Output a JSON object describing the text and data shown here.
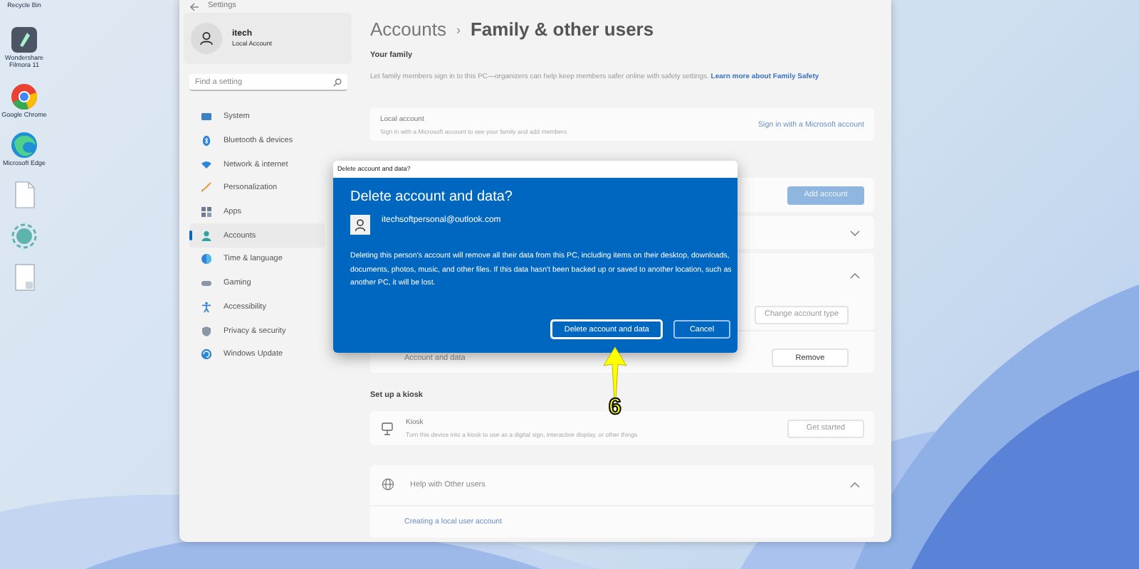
{
  "desktop": {
    "icons": [
      {
        "kind": "label",
        "label": "Recycle Bin"
      },
      {
        "kind": "filmora",
        "label": "Wondershare Filmora 11"
      },
      {
        "kind": "chrome",
        "label": "Google Chrome"
      },
      {
        "kind": "edge",
        "label": "Microsoft Edge"
      },
      {
        "kind": "file"
      },
      {
        "kind": "disc"
      },
      {
        "kind": "doc"
      }
    ]
  },
  "window": {
    "title": "Settings",
    "user": {
      "name": "itech",
      "type": "Local Account"
    },
    "search": {
      "placeholder": "Find a setting"
    },
    "sidebar": {
      "items": [
        {
          "kind": "system",
          "label": "System",
          "selected": false
        },
        {
          "kind": "bluetooth",
          "label": "Bluetooth & devices",
          "selected": false
        },
        {
          "kind": "network",
          "label": "Network & internet",
          "selected": false
        },
        {
          "kind": "personalization",
          "label": "Personalization",
          "selected": false
        },
        {
          "kind": "apps",
          "label": "Apps",
          "selected": false
        },
        {
          "kind": "accounts",
          "label": "Accounts",
          "selected": true
        },
        {
          "kind": "time",
          "label": "Time & language",
          "selected": false
        },
        {
          "kind": "gaming",
          "label": "Gaming",
          "selected": false
        },
        {
          "kind": "accessibility",
          "label": "Accessibility",
          "selected": false
        },
        {
          "kind": "privacy",
          "label": "Privacy & security",
          "selected": false
        },
        {
          "kind": "update",
          "label": "Windows Update",
          "selected": false
        }
      ]
    },
    "breadcrumb": {
      "parent": "Accounts",
      "separator": "›",
      "current": "Family & other users"
    },
    "family": {
      "heading": "Your family",
      "description": "Let family members sign in to this PC—organizers can help keep members safer online with safety settings.",
      "link": "Learn more about Family Safety",
      "card": {
        "title": "Local account",
        "subtitle": "Sign in with a Microsoft account to see your family and add members",
        "action": "Sign in with a Microsoft account"
      }
    },
    "other_users": {
      "add_button": "Add account",
      "account_row": {
        "expanded": true,
        "change_button": "Change account type",
        "data_label": "Account and data",
        "remove_button": "Remove"
      }
    },
    "kiosk": {
      "heading": "Set up a kiosk",
      "title": "Kiosk",
      "subtitle": "Turn this device into a kiosk to use as a digital sign, interactive display, or other things",
      "button": "Get started"
    },
    "help": {
      "title": "Help with Other users",
      "expanded": true,
      "links": [
        "Creating a local user account"
      ]
    }
  },
  "dialog": {
    "title": "Delete account and data?",
    "heading": "Delete account and data?",
    "email": "itechsoftpersonal@outlook.com",
    "message": "Deleting this person's account will remove all their data from this PC, including items on their desktop, downloads, documents, photos, music, and other files. If this data hasn't been backed up or saved to another location, such as another PC, it will be lost.",
    "buttons": [
      {
        "label": "Delete account and data",
        "selected": true
      },
      {
        "label": "Cancel",
        "selected": false
      }
    ]
  },
  "annotation": {
    "number": "6"
  }
}
